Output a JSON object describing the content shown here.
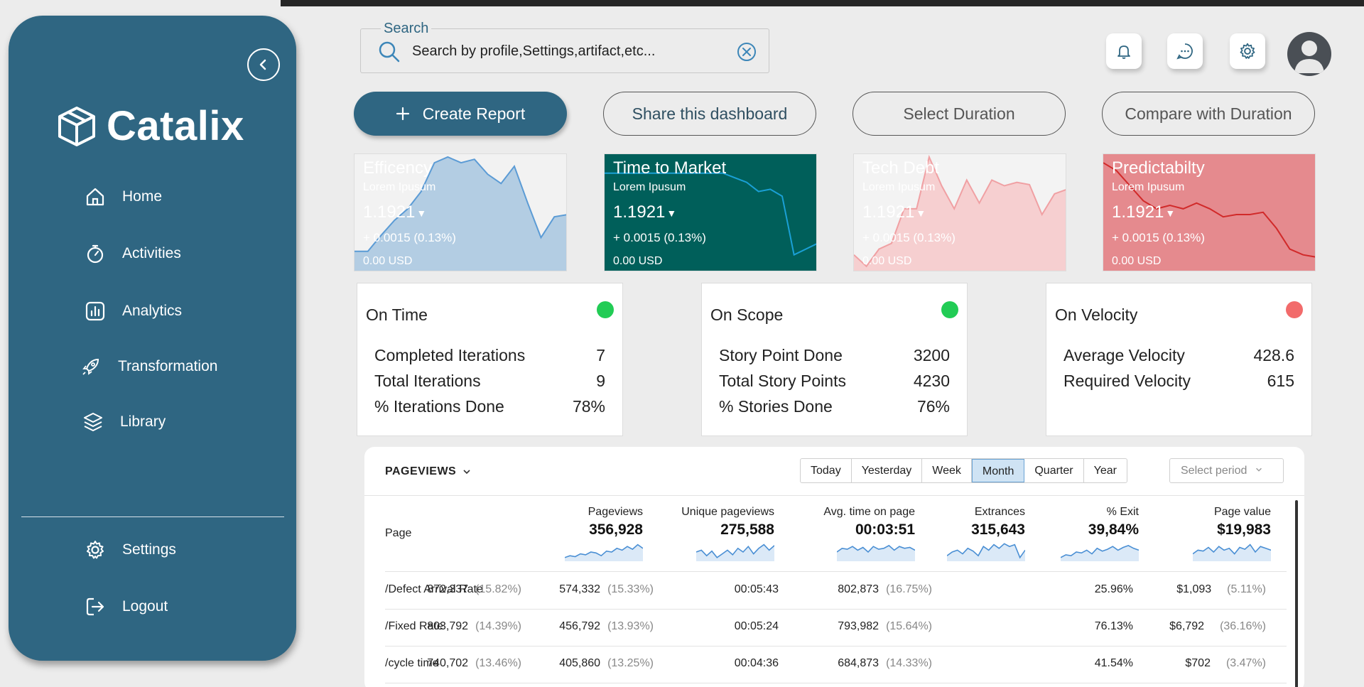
{
  "app": {
    "name": "Catalix"
  },
  "sidebar": {
    "items": [
      {
        "label": "Home",
        "icon": "home-icon"
      },
      {
        "label": "Activities",
        "icon": "stopwatch-icon"
      },
      {
        "label": "Analytics",
        "icon": "analytics-icon"
      },
      {
        "label": "Transformation",
        "icon": "rocket-icon"
      },
      {
        "label": "Library",
        "icon": "layers-icon"
      }
    ],
    "bottom": [
      {
        "label": "Settings",
        "icon": "gear-icon"
      },
      {
        "label": "Logout",
        "icon": "logout-icon"
      }
    ]
  },
  "search": {
    "label": "Search",
    "value": "Search  by profile,Settings,artifact,etc..."
  },
  "actions": {
    "create": "Create Report",
    "share": "Share this dashboard",
    "duration": "Select Duration",
    "compare": "Compare with Duration"
  },
  "mini_cards": [
    {
      "title": "Efficency",
      "sub": "Lorem Ipusum",
      "value": "1.1921",
      "change": "+ 0.0015 (0.13%)",
      "usd": "0.00 USD",
      "color": "#b3cde3",
      "stroke": "#5b9bd5",
      "bg": "#f2f2f2",
      "text_color": "#ffffff",
      "series": [
        0.18,
        0.18,
        0.32,
        0.45,
        0.55,
        0.7,
        0.95,
        1.0,
        0.95,
        0.98,
        0.85,
        0.77,
        0.92,
        0.6,
        0.3,
        0.48,
        0.5
      ]
    },
    {
      "title": "Time to Market",
      "sub": "Lorem Ipusum",
      "value": "1.1921",
      "change": "+ 0.0015 (0.13%)",
      "usd": "0.00 USD",
      "color": "#005f5a",
      "stroke": "#1aa0d6",
      "bg": "#005f5a",
      "text_color": "#ffffff",
      "series": [
        0.86,
        0.86,
        0.86,
        0.86,
        0.86,
        0.86,
        0.86,
        0.86,
        0.86,
        0.86,
        0.86,
        0.82,
        0.78,
        0.7,
        0.72,
        0.66,
        0.15,
        0.2,
        0.25
      ]
    },
    {
      "title": "Tech Debt",
      "sub": "Lorem Ipusum",
      "value": "1.1921",
      "change": "+ 0.0015 (0.13%)",
      "usd": "0.00 USD",
      "color": "#f6cfd0",
      "stroke": "#f0a0a3",
      "bg": "#f3f3f3",
      "text_color": "#ffffff",
      "series": [
        0.15,
        0.05,
        0.2,
        0.25,
        0.55,
        0.55,
        1.0,
        0.75,
        0.55,
        0.8,
        0.6,
        0.8,
        0.75,
        0.78,
        0.76,
        0.5,
        0.68,
        0.72
      ]
    },
    {
      "title": "Predictabilty",
      "sub": "Lorem Ipusum",
      "value": "1.1921",
      "change": "+ 0.0015 (0.13%)",
      "usd": "0.00 USD",
      "color": "#e58a8e",
      "stroke": "#d12a2a",
      "bg": "#e58a8e",
      "text_color": "#ffffff",
      "series": [
        0.95,
        0.88,
        0.75,
        0.62,
        0.55,
        0.58,
        0.55,
        0.6,
        0.55,
        0.48,
        0.5,
        0.5,
        0.52,
        0.38,
        0.2,
        0.15,
        0.13
      ]
    }
  ],
  "kpis": [
    {
      "title": "On Time",
      "status_color": "#22cc55",
      "rows": [
        [
          "Completed Iterations",
          "7"
        ],
        [
          "Total Iterations",
          "9"
        ],
        [
          "% Iterations Done",
          "78%"
        ]
      ]
    },
    {
      "title": "On Scope",
      "status_color": "#22cc55",
      "rows": [
        [
          "Story Point Done",
          "3200"
        ],
        [
          "Total Story Points",
          "4230"
        ],
        [
          "% Stories Done",
          "76%"
        ]
      ]
    },
    {
      "title": "On Velocity",
      "status_color": "#f26b6b",
      "rows": [
        [
          "Average Velocity",
          "428.6"
        ],
        [
          "Required Velocity",
          "615"
        ]
      ]
    }
  ],
  "table": {
    "title": "PAGEVIEWS",
    "periods": [
      "Today",
      "Yesterday",
      "Week",
      "Month",
      "Quarter",
      "Year"
    ],
    "active_period": "Month",
    "select_period": "Select period",
    "page_header": "Page",
    "columns": [
      {
        "label": "Pageviews",
        "total": "356,928"
      },
      {
        "label": "Unique pageviews",
        "total": "275,588"
      },
      {
        "label": "Avg. time on page",
        "total": "00:03:51"
      },
      {
        "label": "Extrances",
        "total": "315,643"
      },
      {
        "label": "% Exit",
        "total": "39,84%"
      },
      {
        "label": "Page value",
        "total": "$19,983"
      }
    ],
    "rows": [
      {
        "page": "/Defect Arrival Rate",
        "pv": "872,337",
        "pv_pct": "(15.82%)",
        "upv": "574,332",
        "upv_pct": "(15.33%)",
        "avg": "00:05:43",
        "ext": "802,873",
        "ext_pct": "(16.75%)",
        "exit": "25.96%",
        "val": "$1,093",
        "val_pct": "(5.11%)"
      },
      {
        "page": "/Fixed Rate",
        "pv": "803,792",
        "pv_pct": "(14.39%)",
        "upv": "456,792",
        "upv_pct": "(13.93%)",
        "avg": "00:05:24",
        "ext": "793,982",
        "ext_pct": "(15.64%)",
        "exit": "76.13%",
        "val": "$6,792",
        "val_pct": "(36.16%)"
      },
      {
        "page": "/cycle time",
        "pv": "740,702",
        "pv_pct": "(13.46%)",
        "upv": "405,860",
        "upv_pct": "(13.25%)",
        "avg": "00:04:36",
        "ext": "684,873",
        "ext_pct": "(14.33%)",
        "exit": "41.54%",
        "val": "$702",
        "val_pct": "(3.47%)"
      }
    ]
  }
}
